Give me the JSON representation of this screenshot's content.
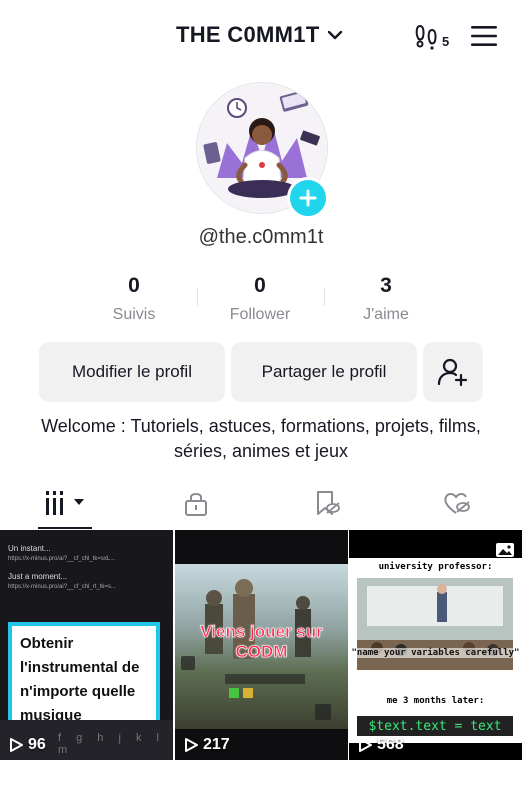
{
  "header": {
    "title": "THE C0MM1T",
    "visitors_badge": "5"
  },
  "profile": {
    "handle": "@the.c0mm1t"
  },
  "stats": [
    {
      "value": "0",
      "label": "Suivis"
    },
    {
      "value": "0",
      "label": "Follower"
    },
    {
      "value": "3",
      "label": "J'aime"
    }
  ],
  "buttons": {
    "edit": "Modifier le profil",
    "share": "Partager le profil"
  },
  "bio": "Welcome : Tutoriels, astuces, formations, projets, films, séries, animes et jeux",
  "videos": [
    {
      "views": "96",
      "caption": "Obtenir l'instrumental de n'importe quelle musique",
      "screen_rows": [
        {
          "title": "Un instant...",
          "sub": "https://x-minus.pro/ai?__cf_chl_tk=sxL..."
        },
        {
          "title": "Just a moment...",
          "sub": "https://x-minus.pro/ai?__cf_chl_rt_tk=s..."
        }
      ],
      "keys": "f g h j k l m"
    },
    {
      "views": "217",
      "caption": "Viens jouer sur CODM"
    },
    {
      "views": "568",
      "meme_top": "university professor:",
      "meme_quote": "\"name your variables carefully\"",
      "meme_later": "me 3 months later:",
      "meme_code": "$text.text = text"
    }
  ],
  "colors": {
    "accent": "#20d5ec",
    "text": "#161823",
    "muted": "#8a8b91",
    "button_bg": "#f1f1f2",
    "caption_border": "#22c6e6",
    "codm_red": "#ff2b55"
  }
}
